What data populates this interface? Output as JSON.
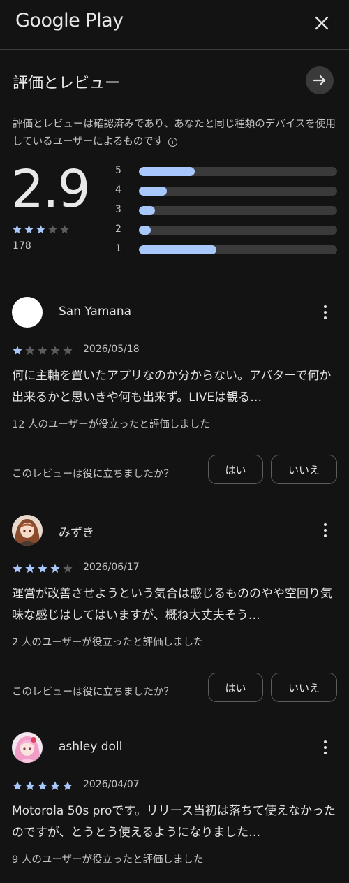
{
  "header": {
    "logo_text": "Google Play"
  },
  "section": {
    "title": "評価とレビュー",
    "description": "評価とレビューは確認済みであり、あなたと同じ種類のデバイスを使用しているユーザーによるものです",
    "info_icon_glyph": "i"
  },
  "summary": {
    "score": "2.9",
    "score_value": 2.9,
    "count": "178",
    "distribution": [
      {
        "label": "5",
        "fraction": 0.28
      },
      {
        "label": "4",
        "fraction": 0.14
      },
      {
        "label": "3",
        "fraction": 0.08
      },
      {
        "label": "2",
        "fraction": 0.06
      },
      {
        "label": "1",
        "fraction": 0.39
      }
    ]
  },
  "reviews": [
    {
      "name": "San Yamana",
      "avatar": "white-circle",
      "rating": 1,
      "date": "2026/05/18",
      "text": "何に主軸を置いたアプリなのか分からない。アバターで何か出来るかと思いきや何も出来ず。LIVEは観る…",
      "helpful": "12 人のユーザーが役立ったと評価しました",
      "question": "このレビューは役に立ちましたか？",
      "yes_label": "はい",
      "no_label": "いいえ"
    },
    {
      "name": "みずき",
      "avatar": "anime-girl-brown-hair",
      "rating": 4,
      "date": "2026/06/17",
      "text": "運営が改善させようという気合は感じるもののやや空回り気味な感じはしてはいますが、概ね大丈夫そう…",
      "helpful": "2 人のユーザーが役立ったと評価しました",
      "question": "このレビューは役に立ちましたか？",
      "yes_label": "はい",
      "no_label": "いいえ"
    },
    {
      "name": "ashley doll",
      "avatar": "anime-girl-pink-hair",
      "rating": 5,
      "date": "2026/04/07",
      "text": "Motorola 50s proです。リリース当初は落ちて使えなかったのですが、とうとう使えるようになりました…",
      "helpful": "9 人のユーザーが役立ったと評価しました"
    }
  ],
  "colors": {
    "background": "#131313",
    "accent": "#a8c7fa",
    "track": "#3a3a3a",
    "star_empty": "#5c5c5c"
  }
}
